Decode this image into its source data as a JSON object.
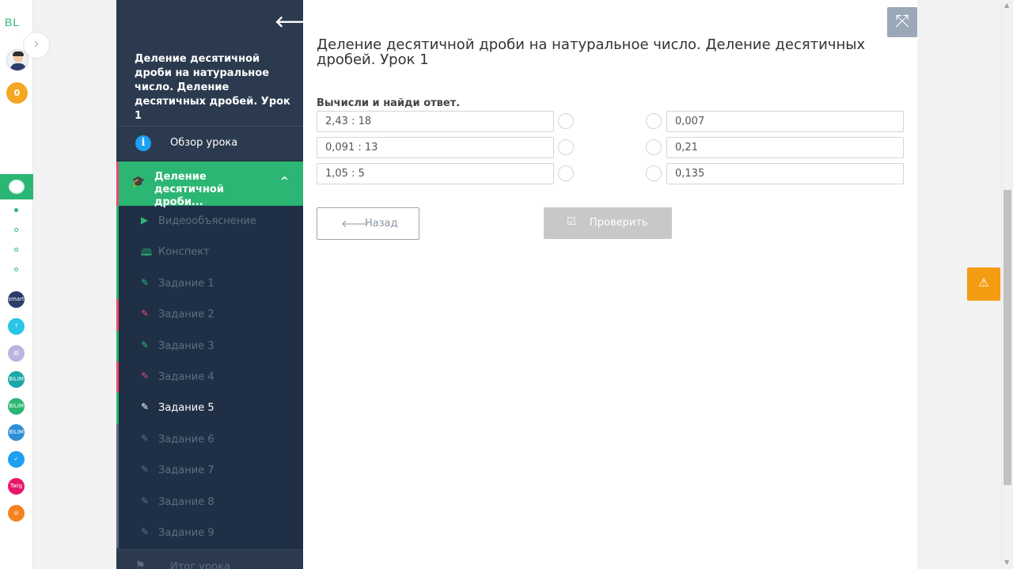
{
  "rail": {
    "logo": "BL",
    "coins": "0",
    "active_icon": "lesson-app-icon",
    "apps": [
      {
        "name": "smart-nation-app",
        "color": "#2b3d6b",
        "text": "smart"
      },
      {
        "name": "help-app",
        "color": "#29c4e8",
        "text": "?"
      },
      {
        "name": "calendar-app",
        "color": "#b8b6e0",
        "text": "▤"
      },
      {
        "name": "bilim-class-app",
        "color": "#1aa8a8",
        "text": "BILIM"
      },
      {
        "name": "bilim-land-app",
        "color": "#2bb673",
        "text": "BILIM"
      },
      {
        "name": "bilim-books-app",
        "color": "#2c8ed6",
        "text": "BILIM"
      },
      {
        "name": "test-app",
        "color": "#1e9ff2",
        "text": "✓"
      },
      {
        "name": "twig-app",
        "color": "#e6166b",
        "text": "Twig"
      },
      {
        "name": "mektep-app",
        "color": "#f58220",
        "text": "◎"
      }
    ]
  },
  "sidebar": {
    "back_icon": "arrow-left-icon",
    "lesson_title": "Деление десятичной дроби на натуральное число. Деление десятичных дробей. Урок 1",
    "overview_label": "Обзор урока",
    "section_label": "Деление десятичной дроби...",
    "items": [
      {
        "label": "Видеообъяснение",
        "icon": "play-icon",
        "state": "green"
      },
      {
        "label": "Конспект",
        "icon": "book-icon",
        "state": "green"
      },
      {
        "label": "Задание 1",
        "icon": "edit-icon",
        "state": "green"
      },
      {
        "label": "Задание 2",
        "icon": "edit-icon",
        "state": "red"
      },
      {
        "label": "Задание 3",
        "icon": "edit-icon",
        "state": "green"
      },
      {
        "label": "Задание 4",
        "icon": "edit-icon",
        "state": "red"
      },
      {
        "label": "Задание 5",
        "icon": "edit-icon",
        "state": "current"
      },
      {
        "label": "Задание 6",
        "icon": "edit-icon",
        "state": "none"
      },
      {
        "label": "Задание 7",
        "icon": "edit-icon",
        "state": "none"
      },
      {
        "label": "Задание 8",
        "icon": "edit-icon",
        "state": "none"
      },
      {
        "label": "Задание 9",
        "icon": "edit-icon",
        "state": "none"
      }
    ],
    "footer_label": "Итог урока"
  },
  "main": {
    "title": "Деление десятичной дроби на натуральное число. Деление десятичных дробей. Урок 1",
    "instruction": "Вычисли и найди ответ.",
    "pairs": [
      {
        "left": "2,43 : 18",
        "right": "0,007"
      },
      {
        "left": "0,091 : 13",
        "right": "0,21"
      },
      {
        "left": "1,05 : 5",
        "right": "0,135"
      }
    ],
    "back_label": "Назад",
    "check_label": "Проверить"
  }
}
